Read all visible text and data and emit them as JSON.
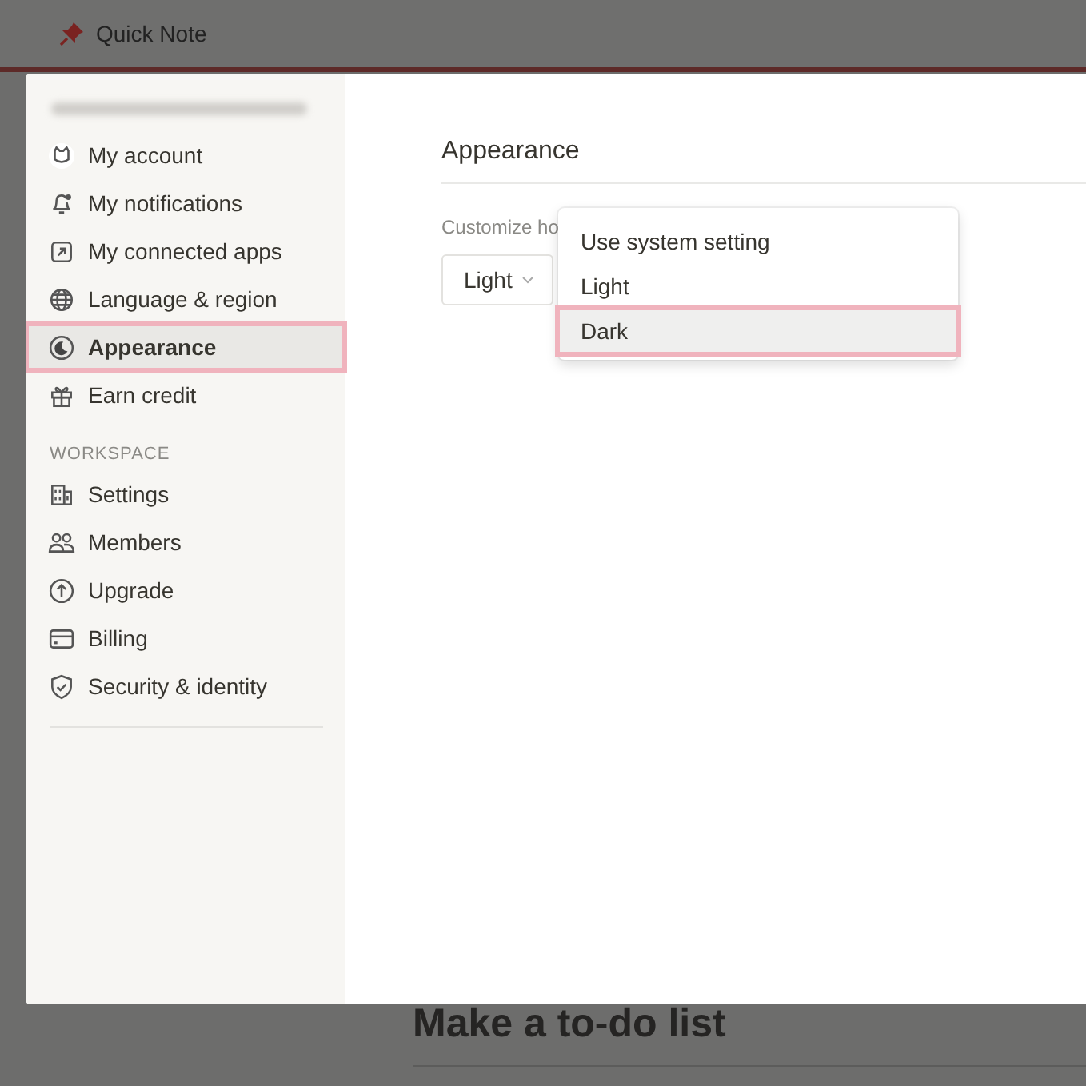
{
  "top_bar": {
    "title": "Quick Note"
  },
  "background_page": {
    "heading": "Make a to-do list"
  },
  "settings": {
    "sidebar": {
      "sections": [
        {
          "items": [
            {
              "label": "My account",
              "selected": false
            },
            {
              "label": "My notifications",
              "selected": false
            },
            {
              "label": "My connected apps",
              "selected": false
            },
            {
              "label": "Language & region",
              "selected": false
            },
            {
              "label": "Appearance",
              "selected": true
            },
            {
              "label": "Earn credit",
              "selected": false
            }
          ]
        },
        {
          "heading": "WORKSPACE",
          "items": [
            {
              "label": "Settings",
              "selected": false
            },
            {
              "label": "Members",
              "selected": false
            },
            {
              "label": "Upgrade",
              "selected": false
            },
            {
              "label": "Billing",
              "selected": false
            },
            {
              "label": "Security & identity",
              "selected": false
            }
          ]
        }
      ]
    },
    "content": {
      "title": "Appearance",
      "description": "Customize ho",
      "select": {
        "value": "Light"
      }
    },
    "menu": {
      "items": [
        {
          "label": "Use system setting",
          "highlighted": false
        },
        {
          "label": "Light",
          "highlighted": false
        },
        {
          "label": "Dark",
          "highlighted": true
        }
      ]
    }
  }
}
